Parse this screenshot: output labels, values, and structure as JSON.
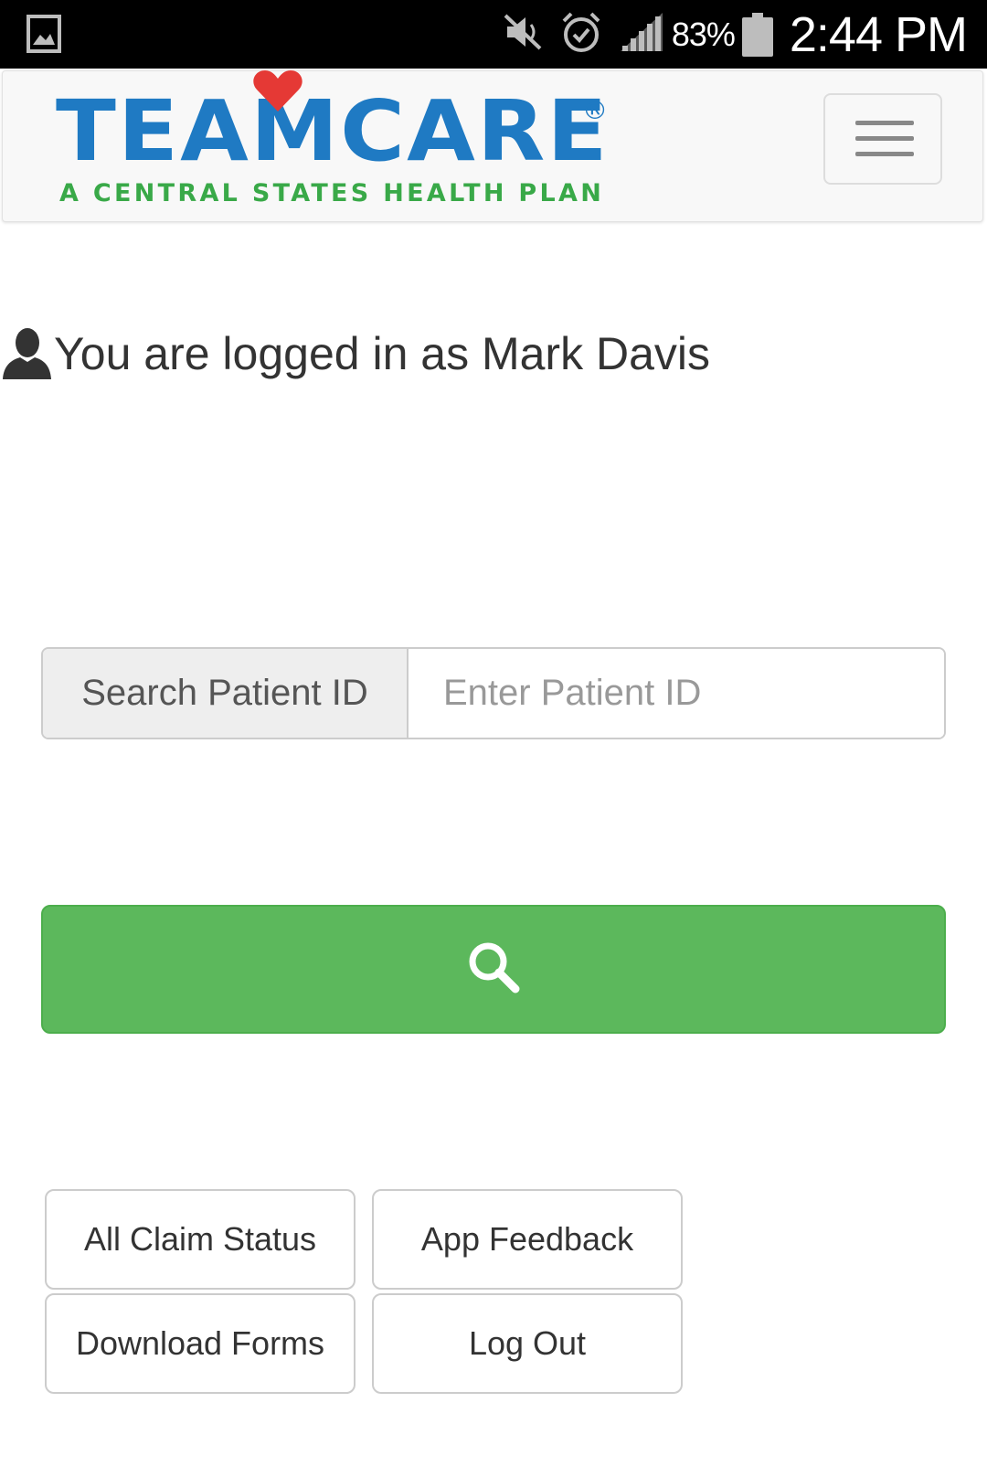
{
  "status_bar": {
    "battery_percent": "83%",
    "time": "2:44 PM",
    "icons": [
      "gallery-icon",
      "mute-icon",
      "alarm-icon",
      "signal-icon",
      "battery-icon"
    ]
  },
  "navbar": {
    "logo": {
      "wordmark": "TEAMCARE",
      "registered_mark": "®",
      "tagline": "A CENTRAL STATES HEALTH PLAN",
      "colors": {
        "wordmark": "#1f7ac3",
        "tagline": "#39a948",
        "heart": "#e53935"
      }
    },
    "menu_icon": "hamburger-icon"
  },
  "user": {
    "logged_in_text": "You are logged in as Mark Davis",
    "icon": "user-icon"
  },
  "search": {
    "addon_label": "Search Patient ID",
    "input_value": "",
    "input_placeholder": "Enter Patient ID",
    "button_icon": "search-icon",
    "button_color": "#5cb85c"
  },
  "actions": {
    "all_claim_status": "All Claim Status",
    "app_feedback": "App Feedback",
    "download_forms": "Download Forms",
    "log_out": "Log Out"
  }
}
